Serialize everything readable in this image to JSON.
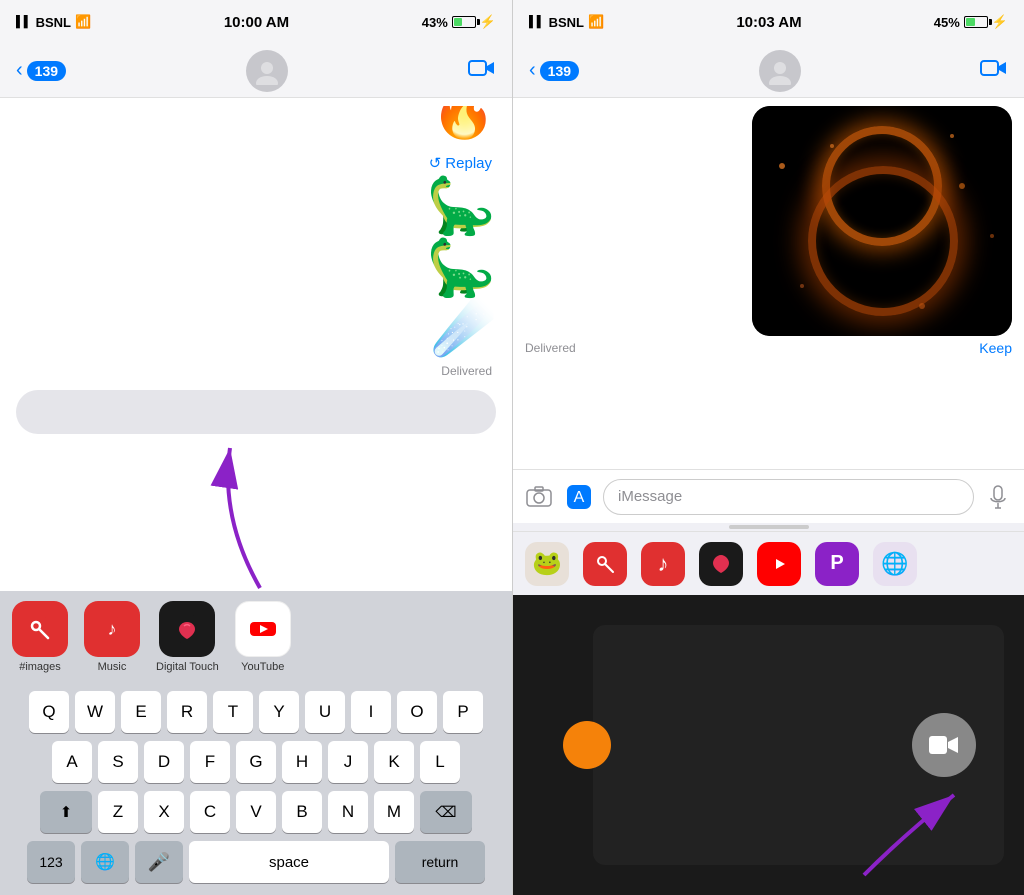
{
  "left": {
    "status": {
      "carrier": "BSNL",
      "time": "10:00 AM",
      "battery": "43%",
      "battery_pct": 43
    },
    "nav": {
      "back_count": "139",
      "video_label": "video-call"
    },
    "messages": {
      "replay_label": "Replay",
      "delivered_label": "Delivered"
    },
    "apps": [
      {
        "id": "images",
        "label": "#images",
        "icon": "🔍"
      },
      {
        "id": "music",
        "label": "Music",
        "icon": "🎵"
      },
      {
        "id": "digital-touch",
        "label": "Digital Touch",
        "icon": "♥"
      },
      {
        "id": "youtube",
        "label": "YouTube",
        "icon": "▶"
      }
    ],
    "keyboard": {
      "rows": [
        [
          "Q",
          "W",
          "E",
          "R",
          "T",
          "Y",
          "U",
          "I",
          "O",
          "P"
        ],
        [
          "A",
          "S",
          "D",
          "F",
          "G",
          "H",
          "J",
          "K",
          "L"
        ],
        [
          "Z",
          "X",
          "C",
          "V",
          "B",
          "N",
          "M"
        ]
      ],
      "num_label": "123",
      "space_label": "space",
      "return_label": "return"
    }
  },
  "right": {
    "status": {
      "carrier": "BSNL",
      "time": "10:03 AM",
      "battery": "45%",
      "battery_pct": 45
    },
    "nav": {
      "back_count": "139"
    },
    "messages": {
      "delivered_label": "Delivered",
      "keep_label": "Keep"
    },
    "input": {
      "placeholder": "iMessage"
    }
  }
}
